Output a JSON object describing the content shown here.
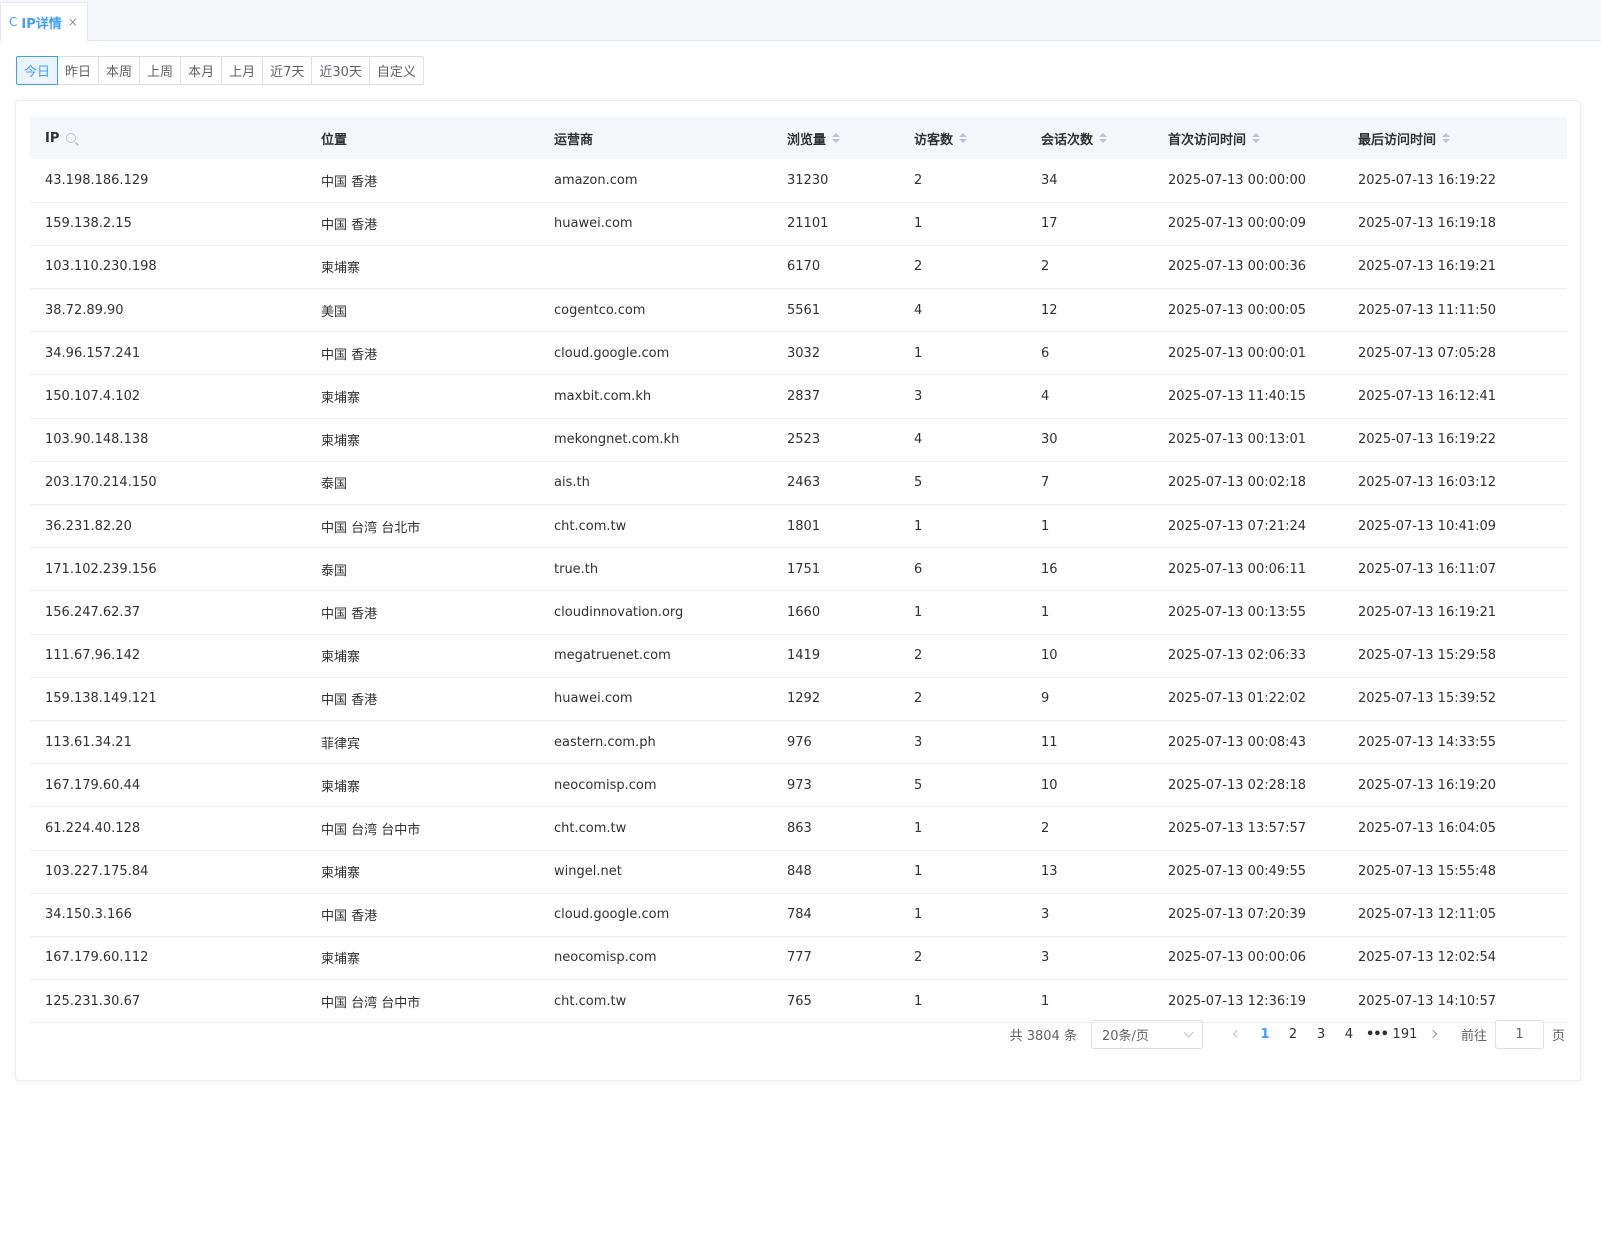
{
  "tab": {
    "label": "IP详情",
    "refresh_glyph": "C",
    "close_glyph": "×",
    "refresh_icon": "refresh-icon",
    "close_icon": "close-icon"
  },
  "date_range": {
    "options": [
      "今日",
      "昨日",
      "本周",
      "上周",
      "本月",
      "上月",
      "近7天",
      "近30天",
      "自定义"
    ],
    "selected": "今日"
  },
  "table": {
    "columns": [
      {
        "key": "ip",
        "label": "IP",
        "filter": "search-icon"
      },
      {
        "key": "location",
        "label": "位置"
      },
      {
        "key": "isp",
        "label": "运营商"
      },
      {
        "key": "pv",
        "label": "浏览量",
        "sortable": true
      },
      {
        "key": "uv",
        "label": "访客数",
        "sortable": true
      },
      {
        "key": "sessions",
        "label": "会话次数",
        "sortable": true
      },
      {
        "key": "first",
        "label": "首次访问时间",
        "sortable": true
      },
      {
        "key": "last",
        "label": "最后访问时间",
        "sortable": true
      }
    ],
    "rows": [
      [
        "43.198.186.129",
        "中国 香港",
        "amazon.com",
        "31230",
        "2",
        "34",
        "2025-07-13 00:00:00",
        "2025-07-13 16:19:22"
      ],
      [
        "159.138.2.15",
        "中国 香港",
        "huawei.com",
        "21101",
        "1",
        "17",
        "2025-07-13 00:00:09",
        "2025-07-13 16:19:18"
      ],
      [
        "103.110.230.198",
        "柬埔寨",
        "",
        "6170",
        "2",
        "2",
        "2025-07-13 00:00:36",
        "2025-07-13 16:19:21"
      ],
      [
        "38.72.89.90",
        "美国",
        "cogentco.com",
        "5561",
        "4",
        "12",
        "2025-07-13 00:00:05",
        "2025-07-13 11:11:50"
      ],
      [
        "34.96.157.241",
        "中国 香港",
        "cloud.google.com",
        "3032",
        "1",
        "6",
        "2025-07-13 00:00:01",
        "2025-07-13 07:05:28"
      ],
      [
        "150.107.4.102",
        "柬埔寨",
        "maxbit.com.kh",
        "2837",
        "3",
        "4",
        "2025-07-13 11:40:15",
        "2025-07-13 16:12:41"
      ],
      [
        "103.90.148.138",
        "柬埔寨",
        "mekongnet.com.kh",
        "2523",
        "4",
        "30",
        "2025-07-13 00:13:01",
        "2025-07-13 16:19:22"
      ],
      [
        "203.170.214.150",
        "泰国",
        "ais.th",
        "2463",
        "5",
        "7",
        "2025-07-13 00:02:18",
        "2025-07-13 16:03:12"
      ],
      [
        "36.231.82.20",
        "中国 台湾 台北市",
        "cht.com.tw",
        "1801",
        "1",
        "1",
        "2025-07-13 07:21:24",
        "2025-07-13 10:41:09"
      ],
      [
        "171.102.239.156",
        "泰国",
        "true.th",
        "1751",
        "6",
        "16",
        "2025-07-13 00:06:11",
        "2025-07-13 16:11:07"
      ],
      [
        "156.247.62.37",
        "中国 香港",
        "cloudinnovation.org",
        "1660",
        "1",
        "1",
        "2025-07-13 00:13:55",
        "2025-07-13 16:19:21"
      ],
      [
        "111.67.96.142",
        "柬埔寨",
        "megatruenet.com",
        "1419",
        "2",
        "10",
        "2025-07-13 02:06:33",
        "2025-07-13 15:29:58"
      ],
      [
        "159.138.149.121",
        "中国 香港",
        "huawei.com",
        "1292",
        "2",
        "9",
        "2025-07-13 01:22:02",
        "2025-07-13 15:39:52"
      ],
      [
        "113.61.34.21",
        "菲律宾",
        "eastern.com.ph",
        "976",
        "3",
        "11",
        "2025-07-13 00:08:43",
        "2025-07-13 14:33:55"
      ],
      [
        "167.179.60.44",
        "柬埔寨",
        "neocomisp.com",
        "973",
        "5",
        "10",
        "2025-07-13 02:28:18",
        "2025-07-13 16:19:20"
      ],
      [
        "61.224.40.128",
        "中国 台湾 台中市",
        "cht.com.tw",
        "863",
        "1",
        "2",
        "2025-07-13 13:57:57",
        "2025-07-13 16:04:05"
      ],
      [
        "103.227.175.84",
        "柬埔寨",
        "wingel.net",
        "848",
        "1",
        "13",
        "2025-07-13 00:49:55",
        "2025-07-13 15:55:48"
      ],
      [
        "34.150.3.166",
        "中国 香港",
        "cloud.google.com",
        "784",
        "1",
        "3",
        "2025-07-13 07:20:39",
        "2025-07-13 12:11:05"
      ],
      [
        "167.179.60.112",
        "柬埔寨",
        "neocomisp.com",
        "777",
        "2",
        "3",
        "2025-07-13 00:00:06",
        "2025-07-13 12:02:54"
      ],
      [
        "125.231.30.67",
        "中国 台湾 台中市",
        "cht.com.tw",
        "765",
        "1",
        "1",
        "2025-07-13 12:36:19",
        "2025-07-13 14:10:57"
      ]
    ]
  },
  "pagination": {
    "total_text": "共 3804 条",
    "page_size": "20条/页",
    "pages": [
      "1",
      "2",
      "3",
      "4"
    ],
    "ellipsis": "•••",
    "last_page": "191",
    "current": "1",
    "goto_prefix": "前往",
    "goto_value": "1",
    "goto_suffix": "页"
  },
  "colors": {
    "accent": "#409eff",
    "text": "#303133",
    "muted": "#606266",
    "border": "#ebeef5"
  }
}
